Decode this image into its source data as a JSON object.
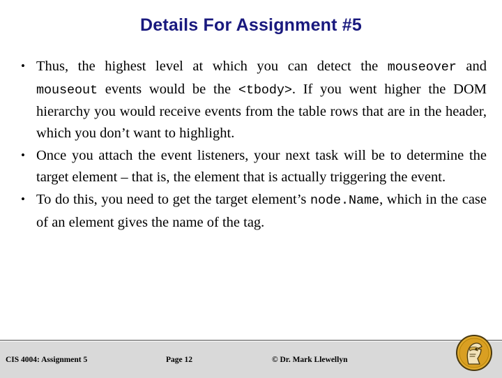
{
  "slide": {
    "title": "Details For Assignment #5",
    "bullets": [
      {
        "marker": "•",
        "segments": [
          {
            "type": "text",
            "text": "Thus, the highest level at which you can detect the "
          },
          {
            "type": "code",
            "text": "mouseover"
          },
          {
            "type": "text",
            "text": " and "
          },
          {
            "type": "code",
            "text": "mouseout"
          },
          {
            "type": "text",
            "text": " events would be the "
          },
          {
            "type": "code",
            "text": "<tbody>"
          },
          {
            "type": "text",
            "text": ".  If you went higher the DOM hierarchy you would receive events from the table rows that are in the header, which you don’t want to highlight."
          }
        ]
      },
      {
        "marker": "•",
        "segments": [
          {
            "type": "text",
            "text": "Once you attach the event listeners, your next task will be to determine the target element – that is, the element that is actually triggering the event."
          }
        ]
      },
      {
        "marker": "•",
        "segments": [
          {
            "type": "text",
            "text": "To do this, you need to get the target element’s "
          },
          {
            "type": "code",
            "text": "node.Name"
          },
          {
            "type": "text",
            "text": ", which in the case of an element gives the name of the tag."
          }
        ]
      }
    ]
  },
  "footer": {
    "left": "CIS 4004:  Assignment 5",
    "center": "Page 12",
    "right": "© Dr. Mark Llewellyn"
  },
  "logo": {
    "name": "ucf-knight-logo",
    "colors": {
      "gold": "#e0a92c",
      "gold_dark": "#b8860b",
      "outline": "#4a3a10",
      "face": "#f2e2b8"
    }
  },
  "colors": {
    "title": "#19197e",
    "footer_band": "#d9d9d9",
    "footer_rule": "#9a9a9a",
    "body_text": "#000000",
    "background": "#ffffff"
  }
}
